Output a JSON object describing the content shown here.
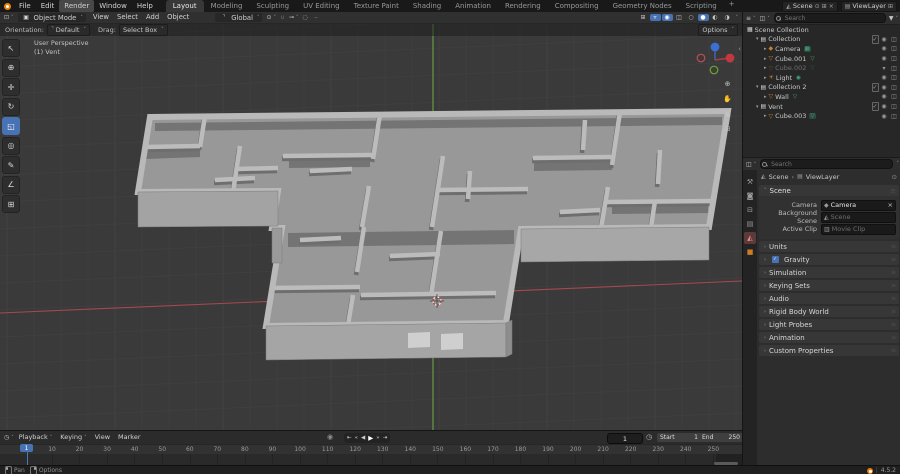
{
  "topbar": {
    "menus": [
      "File",
      "Edit",
      "Render",
      "Window",
      "Help"
    ],
    "highlighted_menu": "Render",
    "workspace_tabs": [
      "Layout",
      "Modeling",
      "Sculpting",
      "UV Editing",
      "Texture Paint",
      "Shading",
      "Animation",
      "Rendering",
      "Compositing",
      "Geometry Nodes",
      "Scripting"
    ],
    "active_tab": "Layout",
    "add_workspace_label": "+",
    "scene_selector": {
      "value": "Scene"
    },
    "viewlayer_selector": {
      "value": "ViewLayer"
    }
  },
  "tool_header": {
    "mode": "Object Mode",
    "menus": [
      "View",
      "Select",
      "Add",
      "Object"
    ],
    "transform_orientation": "Global",
    "middle_icons": [
      "transform-pivot",
      "snap-magnet",
      "snap-target",
      "proportional-editing",
      "proportional-falloff"
    ],
    "right_icons": [
      "object-type-visibility",
      "gizmos-toggle",
      "overlays-toggle",
      "xray-toggle",
      "shading-wireframe",
      "shading-solid",
      "shading-material",
      "shading-rendered"
    ],
    "options_label": "Options"
  },
  "overlay_bar": {
    "orientation_label": "Orientation:",
    "orientation_value": "Default",
    "drag_label": "Drag:",
    "drag_value": "Select Box"
  },
  "viewport": {
    "perspective_label": "User Perspective",
    "active_collection_label": "(1) Vent",
    "tools": [
      "tweak-select",
      "cursor",
      "move",
      "rotate",
      "scale",
      "transform",
      "annotate",
      "measure",
      "add-cube"
    ],
    "active_tool": "scale",
    "nav_icons": [
      "zoom",
      "pan-hand",
      "camera-view",
      "toggle-perspective"
    ]
  },
  "outliner": {
    "search_placeholder": "Search",
    "header_icons": [
      "display-mode",
      "filter-objects",
      "filter-funnel"
    ],
    "rows": [
      {
        "label": "Scene Collection",
        "depth": 0,
        "icon": "scene-collection",
        "toggles": []
      },
      {
        "label": "Collection",
        "depth": 1,
        "icon": "collection",
        "expanded": true,
        "toggles": [
          "checkbox",
          "eye",
          "camera"
        ]
      },
      {
        "label": "Camera",
        "depth": 2,
        "icon": "camera",
        "expanded": false,
        "badge": "camera-data",
        "badge_selected": true,
        "toggles": [
          "eye",
          "camera"
        ]
      },
      {
        "label": "Cube.001",
        "depth": 2,
        "icon": "mesh",
        "expanded": false,
        "badge": "mesh-data",
        "toggles": [
          "eye",
          "camera"
        ]
      },
      {
        "label": "Cube.002",
        "depth": 2,
        "icon": "mesh",
        "expanded": false,
        "badge": "mesh-data",
        "muted": true,
        "toggles": [
          "eye-closed",
          "camera"
        ]
      },
      {
        "label": "Light",
        "depth": 2,
        "icon": "light",
        "expanded": false,
        "badge": "light-data",
        "toggles": [
          "eye",
          "camera"
        ]
      },
      {
        "label": "Collection 2",
        "depth": 1,
        "icon": "collection",
        "expanded": true,
        "toggles": [
          "checkbox",
          "eye",
          "camera"
        ]
      },
      {
        "label": "Wall",
        "depth": 2,
        "icon": "mesh",
        "expanded": false,
        "badge": "mesh-data",
        "toggles": [
          "eye",
          "camera"
        ]
      },
      {
        "label": "Vent",
        "depth": 1,
        "icon": "collection",
        "expanded": true,
        "toggles": [
          "checkbox",
          "eye",
          "camera"
        ]
      },
      {
        "label": "Cube.003",
        "depth": 2,
        "icon": "mesh",
        "expanded": false,
        "badge": "mesh-data",
        "badge_selected": true,
        "toggles": [
          "eye",
          "camera"
        ]
      }
    ]
  },
  "properties": {
    "search_placeholder": "Search",
    "tabs": [
      "tool",
      "render",
      "output",
      "view-layer",
      "scene",
      "object"
    ],
    "active_tab": "scene",
    "breadcrumb": {
      "scene": "Scene",
      "separator": "›",
      "viewlayer": "ViewLayer"
    },
    "scene_panel": {
      "title": "Scene",
      "camera_label": "Camera",
      "camera_value": "Camera",
      "background_label": "Background Scene",
      "background_placeholder": "Scene",
      "clip_label": "Active Clip",
      "clip_placeholder": "Movie Clip"
    },
    "panels": [
      {
        "label": "Units"
      },
      {
        "label": "Gravity",
        "checkbox": true
      },
      {
        "label": "Simulation"
      },
      {
        "label": "Keying Sets"
      },
      {
        "label": "Audio"
      },
      {
        "label": "Rigid Body World"
      },
      {
        "label": "Light Probes"
      },
      {
        "label": "Animation"
      },
      {
        "label": "Custom Properties"
      }
    ]
  },
  "timeline": {
    "menus": [
      "Playback",
      "Keying",
      "View",
      "Marker"
    ],
    "dropdown_menus": [
      "Playback",
      "Keying"
    ],
    "transport": [
      "jump-start",
      "prev-keyframe",
      "play-reverse",
      "play",
      "next-keyframe",
      "jump-end"
    ],
    "current_frame": "1",
    "start_label": "Start",
    "start_value": "1",
    "end_label": "End",
    "end_value": "250",
    "ticks": [
      10,
      20,
      30,
      40,
      50,
      60,
      70,
      80,
      90,
      100,
      110,
      120,
      130,
      140,
      150,
      160,
      170,
      180,
      190,
      200,
      210,
      220,
      230,
      240,
      250
    ]
  },
  "statusbar": {
    "left_hints": [
      {
        "button": "left",
        "label": "Pan"
      },
      {
        "button": "right",
        "label": "Options"
      }
    ],
    "version": "4.5.2"
  },
  "colors": {
    "accent": "#4772b3",
    "object_orange": "#e8860c",
    "data_green": "#3fae7d",
    "axis_red": "#a6494f",
    "axis_green": "#6ba344"
  }
}
